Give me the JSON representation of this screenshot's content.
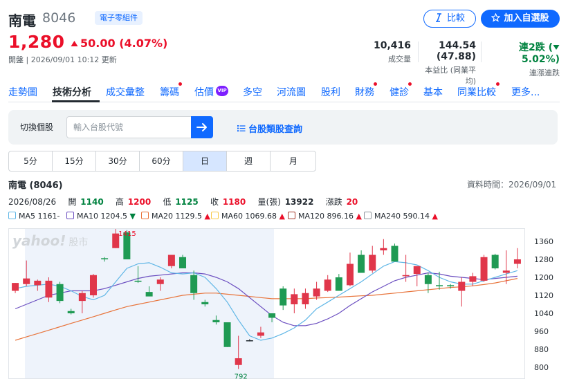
{
  "stock": {
    "name": "南電",
    "code": "8046",
    "sector": "電子零組件",
    "price": "1,280",
    "change": "50.00",
    "change_pct": "(4.07%)",
    "status": "開盤 | 2026/09/01 10:12 更新"
  },
  "actions": {
    "compare": "比較",
    "watchlist": "加入自選股"
  },
  "stats": {
    "volume_value": "10,416",
    "volume_label": "成交量",
    "pe_value": "144.54 (47.88)",
    "pe_label": "本益比 (同業平均)",
    "streak_value": "連2跌 (",
    "streak_pct": "5.02%)",
    "streak_label": "連漲連跌"
  },
  "tabs": [
    {
      "label": "走勢圖"
    },
    {
      "label": "技術分析"
    },
    {
      "label": "成交彙整"
    },
    {
      "label": "籌碼"
    },
    {
      "label": "估價"
    },
    {
      "label": "多空"
    },
    {
      "label": "河流圖"
    },
    {
      "label": "股利"
    },
    {
      "label": "財務"
    },
    {
      "label": "健診"
    },
    {
      "label": "基本"
    },
    {
      "label": "同業比較"
    },
    {
      "label": "更多..."
    }
  ],
  "vip_badge": "VIP",
  "search": {
    "label": "切換個股",
    "placeholder": "輸入台股代號",
    "category_link": "台股類股查詢"
  },
  "periods": [
    "5分",
    "15分",
    "30分",
    "60分",
    "日",
    "週",
    "月"
  ],
  "selected_period": "日",
  "chart_header": {
    "title": "南電 (8046)",
    "data_time": "資料時間：2026/09/01",
    "date": "2026/08/26",
    "open_label": "開",
    "open": "1140",
    "high_label": "高",
    "high": "1200",
    "low_label": "低",
    "low": "1125",
    "close_label": "收",
    "close": "1180",
    "volume_label": "量(張)",
    "volume": "13922",
    "change_label": "漲跌",
    "change": "20"
  },
  "ma_legend": [
    {
      "name": "MA5",
      "value": "1161",
      "trend": "-",
      "color": "#5fb6e6"
    },
    {
      "name": "MA10",
      "value": "1204.5",
      "trend": "▼",
      "color": "#6b4ec0"
    },
    {
      "name": "MA20",
      "value": "1129.5",
      "trend": "▲",
      "color": "#e8743b"
    },
    {
      "name": "MA60",
      "value": "1069.68",
      "trend": "▲",
      "color": "#f7c948"
    },
    {
      "name": "MA120",
      "value": "896.16",
      "trend": "▲",
      "color": "#a53527"
    },
    {
      "name": "MA240",
      "value": "590.14",
      "trend": "▲",
      "color": "#8b949c"
    }
  ],
  "chart_data": {
    "type": "candlestick",
    "watermark": "yahoo!",
    "watermark_sub": "股市",
    "y_ticks": [
      1360,
      1280,
      1200,
      1120,
      1040,
      960,
      880,
      800
    ],
    "ylim": [
      760,
      1400
    ],
    "high_label": "1415",
    "low_label": "792",
    "candles": [
      {
        "o": 1140,
        "h": 1175,
        "l": 1130,
        "c": 1175
      },
      {
        "o": 1170,
        "h": 1275,
        "l": 1160,
        "c": 1195
      },
      {
        "o": 1165,
        "h": 1190,
        "l": 1140,
        "c": 1185
      },
      {
        "o": 1110,
        "h": 1200,
        "l": 1090,
        "c": 1185
      },
      {
        "o": 1170,
        "h": 1180,
        "l": 1085,
        "c": 1095
      },
      {
        "o": 1050,
        "h": 1060,
        "l": 1035,
        "c": 1040
      },
      {
        "o": 1095,
        "h": 1140,
        "l": 1040,
        "c": 1130
      },
      {
        "o": 1120,
        "h": 1215,
        "l": 1110,
        "c": 1210
      },
      {
        "o": 1285,
        "h": 1290,
        "l": 1270,
        "c": 1280
      },
      {
        "o": 1330,
        "h": 1415,
        "l": 1330,
        "c": 1395
      },
      {
        "o": 1400,
        "h": 1410,
        "l": 1280,
        "c": 1280
      },
      {
        "o": 1185,
        "h": 1250,
        "l": 1175,
        "c": 1180
      },
      {
        "o": 1135,
        "h": 1160,
        "l": 1125,
        "c": 1115
      },
      {
        "o": 1170,
        "h": 1200,
        "l": 1140,
        "c": 1190
      },
      {
        "o": 1250,
        "h": 1300,
        "l": 1240,
        "c": 1300
      },
      {
        "o": 1290,
        "h": 1300,
        "l": 1240,
        "c": 1240
      },
      {
        "o": 1210,
        "h": 1230,
        "l": 1100,
        "c": 1130
      },
      {
        "o": 1090,
        "h": 1100,
        "l": 1070,
        "c": 1080
      },
      {
        "o": 1010,
        "h": 1030,
        "l": 990,
        "c": 1000
      },
      {
        "o": 1000,
        "h": 1000,
        "l": 890,
        "c": 890
      },
      {
        "o": 810,
        "h": 940,
        "l": 792,
        "c": 840
      },
      {
        "o": 920,
        "h": 925,
        "l": 915,
        "c": 920
      },
      {
        "o": 940,
        "h": 980,
        "l": 930,
        "c": 955
      },
      {
        "o": 1040,
        "h": 1040,
        "l": 1000,
        "c": 1020
      },
      {
        "o": 1150,
        "h": 1160,
        "l": 1055,
        "c": 1075
      },
      {
        "o": 1080,
        "h": 1150,
        "l": 1040,
        "c": 1125
      },
      {
        "o": 1080,
        "h": 1150,
        "l": 1060,
        "c": 1130
      },
      {
        "o": 1115,
        "h": 1180,
        "l": 1100,
        "c": 1150
      },
      {
        "o": 1140,
        "h": 1210,
        "l": 1135,
        "c": 1190
      },
      {
        "o": 1200,
        "h": 1215,
        "l": 1140,
        "c": 1140
      },
      {
        "o": 1165,
        "h": 1310,
        "l": 1160,
        "c": 1260
      },
      {
        "o": 1300,
        "h": 1320,
        "l": 1220,
        "c": 1220
      },
      {
        "o": 1230,
        "h": 1340,
        "l": 1220,
        "c": 1300
      },
      {
        "o": 1320,
        "h": 1370,
        "l": 1300,
        "c": 1330
      },
      {
        "o": 1340,
        "h": 1350,
        "l": 1270,
        "c": 1270
      },
      {
        "o": 1205,
        "h": 1300,
        "l": 1180,
        "c": 1210
      },
      {
        "o": 1215,
        "h": 1250,
        "l": 1160,
        "c": 1250
      },
      {
        "o": 1210,
        "h": 1220,
        "l": 1130,
        "c": 1170
      },
      {
        "o": 1165,
        "h": 1225,
        "l": 1145,
        "c": 1160
      },
      {
        "o": 1165,
        "h": 1170,
        "l": 1150,
        "c": 1160
      },
      {
        "o": 1140,
        "h": 1200,
        "l": 1070,
        "c": 1180
      },
      {
        "o": 1180,
        "h": 1220,
        "l": 1160,
        "c": 1205
      },
      {
        "o": 1185,
        "h": 1300,
        "l": 1180,
        "c": 1290
      },
      {
        "o": 1300,
        "h": 1305,
        "l": 1235,
        "c": 1240
      },
      {
        "o": 1220,
        "h": 1320,
        "l": 1170,
        "c": 1230
      },
      {
        "o": 1260,
        "h": 1330,
        "l": 1240,
        "c": 1280
      }
    ],
    "ma5": [
      1150,
      1160,
      1165,
      1170,
      1160,
      1140,
      1115,
      1100,
      1120,
      1180,
      1240,
      1260,
      1265,
      1245,
      1220,
      1215,
      1220,
      1200,
      1150,
      1090,
      1010,
      940,
      920,
      930,
      950,
      975,
      1010,
      1060,
      1090,
      1120,
      1150,
      1180,
      1215,
      1250,
      1270,
      1265,
      1255,
      1230,
      1200,
      1180,
      1170,
      1170,
      1185,
      1200,
      1215,
      1230
    ],
    "ma10": [
      1060,
      1080,
      1100,
      1120,
      1130,
      1140,
      1140,
      1140,
      1150,
      1165,
      1180,
      1195,
      1205,
      1210,
      1215,
      1220,
      1220,
      1215,
      1200,
      1180,
      1150,
      1110,
      1070,
      1030,
      1000,
      985,
      985,
      995,
      1015,
      1040,
      1075,
      1105,
      1135,
      1160,
      1185,
      1200,
      1210,
      1220,
      1215,
      1205,
      1200,
      1195,
      1190,
      1195,
      1200,
      1205
    ],
    "ma20": [
      920,
      935,
      950,
      965,
      980,
      995,
      1010,
      1025,
      1040,
      1055,
      1070,
      1080,
      1090,
      1100,
      1110,
      1120,
      1125,
      1130,
      1130,
      1125,
      1120,
      1115,
      1110,
      1105,
      1105,
      1105,
      1105,
      1108,
      1110,
      1112,
      1115,
      1118,
      1120,
      1125,
      1130,
      1135,
      1140,
      1145,
      1150,
      1155,
      1158,
      1162,
      1168,
      1175,
      1185,
      1195
    ]
  }
}
